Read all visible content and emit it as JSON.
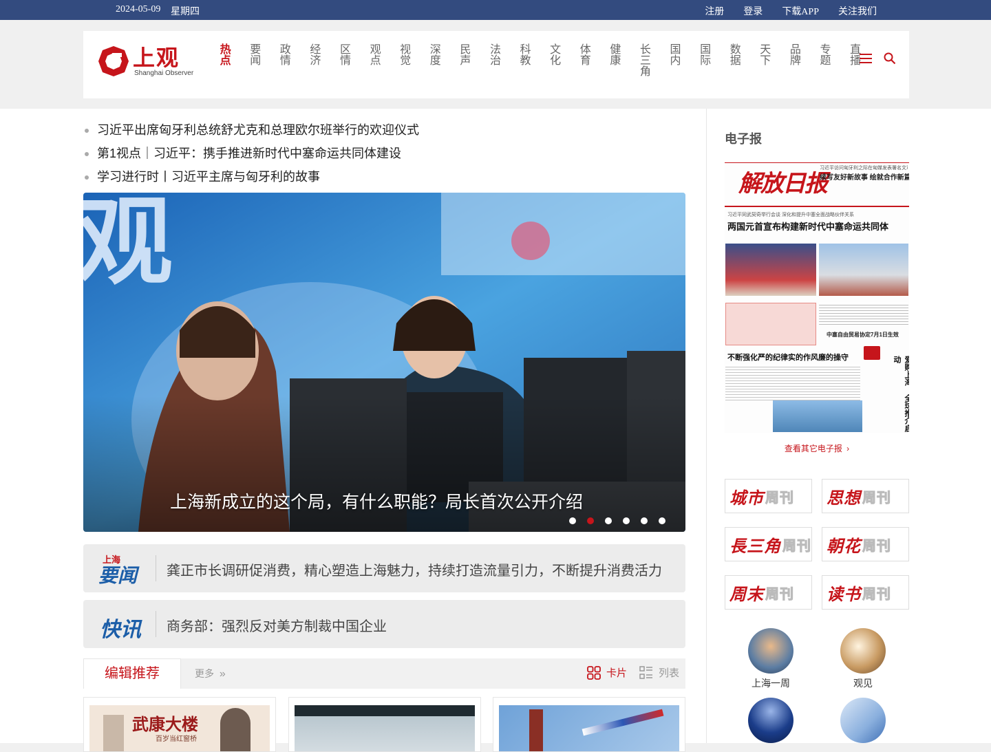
{
  "topbar": {
    "date": "2024-05-09",
    "weekday": "星期四",
    "links": [
      "注册",
      "登录",
      "下载APP",
      "关注我们"
    ]
  },
  "header": {
    "logo_cn": "上观",
    "logo_en": "Shanghai Observer",
    "nav": [
      "热点",
      "要闻",
      "政情",
      "经济",
      "区情",
      "观点",
      "视觉",
      "深度",
      "民声",
      "法治",
      "科教",
      "文化",
      "体育",
      "健康",
      "长三角",
      "国内",
      "国际",
      "数据",
      "天下",
      "品牌",
      "专题",
      "直播"
    ],
    "active_nav": "热点"
  },
  "headlines": [
    "习近平出席匈牙利总统舒尤克和总理欧尔班举行的欢迎仪式",
    "第1视点｜习近平：携手推进新时代中塞命运共同体建设",
    "学习进行时丨习近平主席与匈牙利的故事"
  ],
  "carousel": {
    "caption": "上海新成立的这个局，有什么职能？局长首次公开介绍",
    "slide_count": 6,
    "active_index": 1
  },
  "news_bars": [
    {
      "tag_top": "上海",
      "tag_main": "要闻",
      "text": "龚正市长调研促消费，精心塑造上海魅力，持续打造流量引力，不断提升消费活力"
    },
    {
      "tag_top": "",
      "tag_main": "快讯",
      "text": "商务部：强烈反对美方制裁中国企业"
    }
  ],
  "recommend": {
    "title": "编辑推荐",
    "more": "更多",
    "card_label": "卡片",
    "list_label": "列表",
    "cards": [
      {
        "thumb_text": "武康大楼",
        "thumb_sub": "百岁当红窗桥"
      },
      {
        "thumb_text": "",
        "thumb_sub": ""
      },
      {
        "thumb_text": "",
        "thumb_sub": ""
      }
    ]
  },
  "sidebar": {
    "epaper_title": "电子报",
    "epaper": {
      "masthead": "解放日报",
      "top_small": "习近平访问匈牙利之际在匈媒发表署名文章",
      "top_headline": "续写友好新故事 绘就合作新篇章",
      "sub_small": "习近平同武契奇举行会谈 深化和提升中塞全面战略伙伴关系",
      "main_headline": "两国元首宣布构建新时代中塞命运共同体",
      "mid_right": "中塞自由贸易协定7月1日生效",
      "lower_headline": "不断强化严的纪律实的作风廉的操守",
      "side_vertical": "爱购上海 全球推介启动"
    },
    "epaper_more": "查看其它电子报",
    "weeklies": [
      {
        "name": "城市",
        "kan": "周刊"
      },
      {
        "name": "思想",
        "kan": "周刊"
      },
      {
        "name": "長三角",
        "kan": "周刊"
      },
      {
        "name": "朝花",
        "kan": "周刊"
      },
      {
        "name": "周末",
        "kan": "周刊"
      },
      {
        "name": "读书",
        "kan": "周刊"
      }
    ],
    "circles": [
      {
        "label": "上海一周"
      },
      {
        "label": "观见"
      },
      {
        "label": ""
      },
      {
        "label": ""
      }
    ]
  },
  "colors": {
    "topbar": "#334b7f",
    "accent_red": "#c6151b",
    "newsbar_bg": "#ececec"
  }
}
